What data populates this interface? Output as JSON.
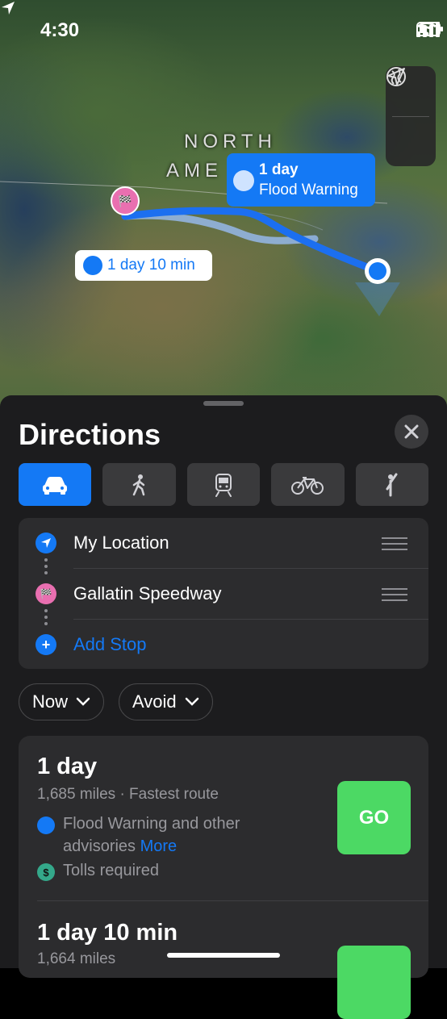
{
  "status_bar": {
    "time": "4:30"
  },
  "map": {
    "label_line1": "NORTH",
    "label_line2": "AME",
    "primary_route_duration": "1 day",
    "primary_route_advisory": "Flood Warning",
    "alt_route_duration": "1 day 10 min"
  },
  "sheet": {
    "title": "Directions",
    "modes": [
      "drive",
      "walk",
      "transit",
      "cycle",
      "rideshare"
    ],
    "stops": [
      {
        "label": "My Location"
      },
      {
        "label": "Gallatin Speedway"
      },
      {
        "label": "Add Stop"
      }
    ],
    "options": {
      "now": "Now",
      "avoid": "Avoid"
    },
    "routes": [
      {
        "duration": "1 day",
        "details": "1,685 miles · Fastest route",
        "advisory": "Flood Warning and other",
        "advisory_line2": "advisories",
        "advisory_more": "More",
        "tolls": "Tolls required",
        "go": "GO"
      },
      {
        "duration": "1 day 10 min",
        "details": "1,664 miles"
      }
    ]
  },
  "colors": {
    "accent": "#1479f5",
    "go": "#4cd964",
    "sheet_bg": "#1c1c1e",
    "card_bg": "#2c2c2e"
  }
}
